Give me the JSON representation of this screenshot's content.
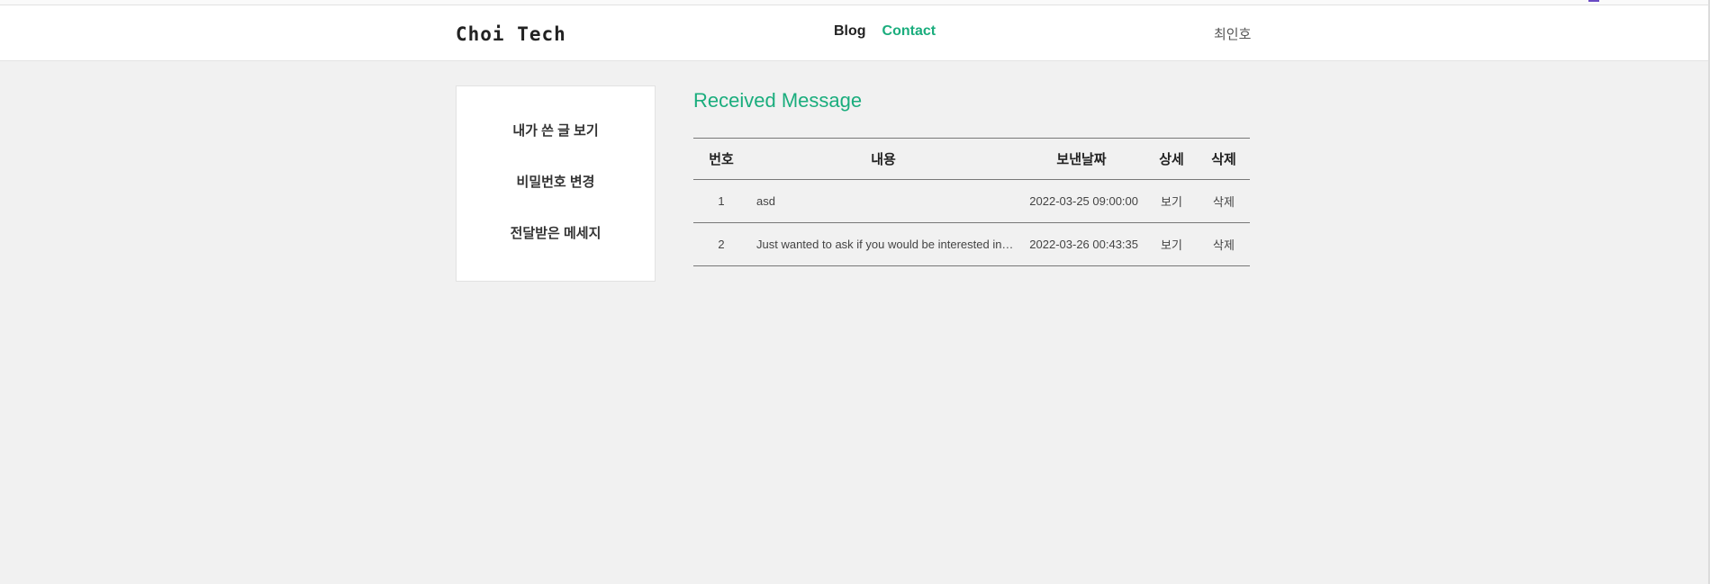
{
  "header": {
    "logo": "Choi Tech",
    "nav": [
      {
        "label": "Blog",
        "active": false
      },
      {
        "label": "Contact",
        "active": true
      }
    ],
    "user_name": "최인호"
  },
  "sidebar": {
    "items": [
      {
        "label": "내가 쓴 글 보기"
      },
      {
        "label": "비밀번호 변경"
      },
      {
        "label": "전달받은 메세지"
      }
    ]
  },
  "main": {
    "title": "Received Message",
    "table": {
      "headers": [
        "번호",
        "내용",
        "보낸날짜",
        "상세",
        "삭제"
      ],
      "rows": [
        {
          "no": "1",
          "content": "asd",
          "date": "2022-03-25 09:00:00",
          "detail": "보기",
          "delete": "삭제"
        },
        {
          "no": "2",
          "content": "Just wanted to ask if you would be interested in…",
          "date": "2022-03-26 00:43:35",
          "detail": "보기",
          "delete": "삭제"
        }
      ]
    }
  },
  "colors": {
    "accent": "#1aad7d",
    "background": "#f1f1f1"
  }
}
